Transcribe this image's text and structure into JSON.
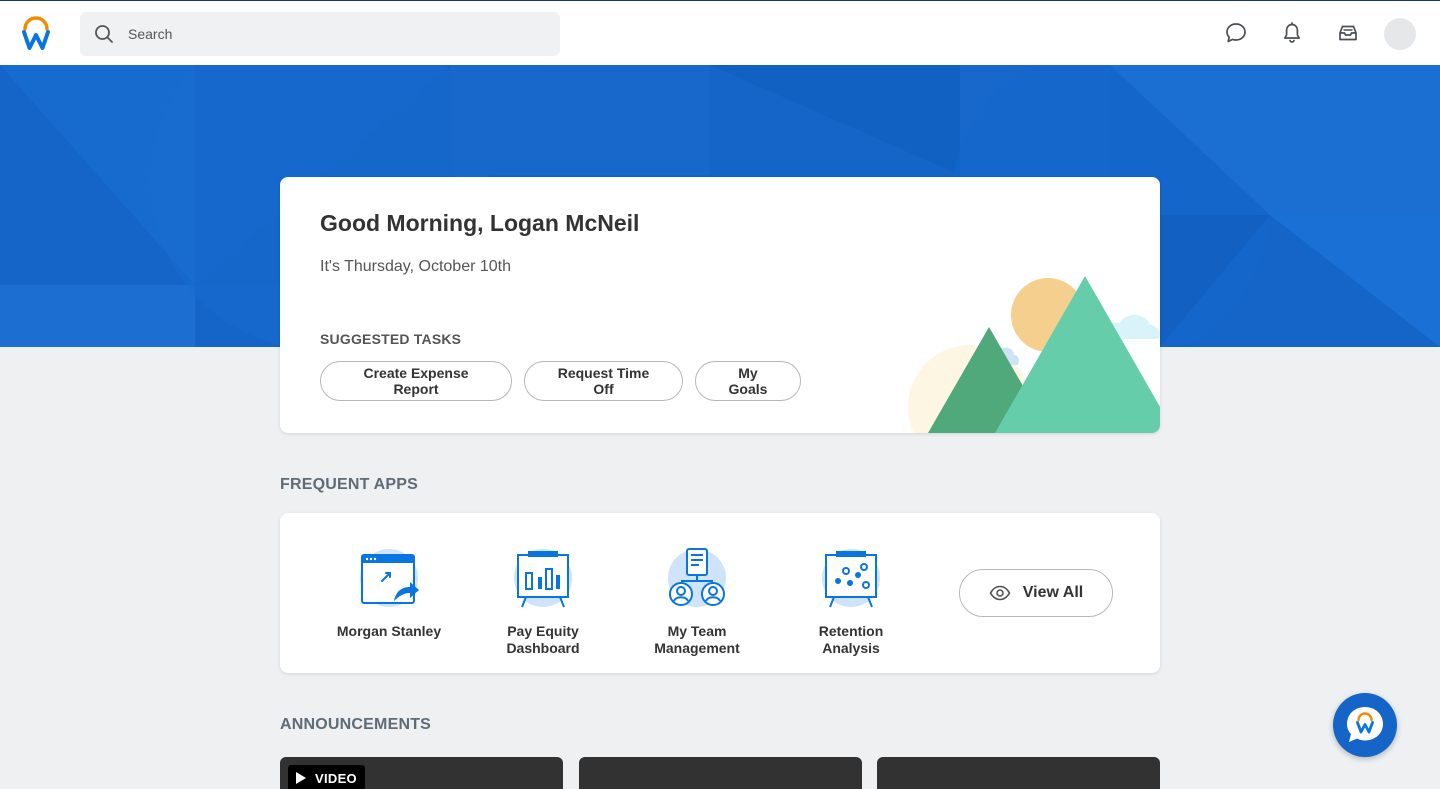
{
  "header": {
    "logo_name": "workday-logo",
    "search": {
      "placeholder": "Search",
      "value": ""
    },
    "icons": [
      "chat-icon",
      "notifications-icon",
      "inbox-icon"
    ]
  },
  "greeting": {
    "title": "Good Morning, Logan McNeil",
    "date": "It's Thursday, October 10th",
    "suggested_label": "SUGGESTED TASKS",
    "tasks": [
      {
        "label": "Create Expense Report"
      },
      {
        "label": "Request Time Off"
      },
      {
        "label": "My Goals"
      }
    ]
  },
  "frequent_apps": {
    "title": "FREQUENT APPS",
    "apps": [
      {
        "line1": "Morgan Stanley",
        "line2": "",
        "icon": "external-link-icon"
      },
      {
        "line1": "Pay Equity",
        "line2": "Dashboard",
        "icon": "bar-chart-board-icon"
      },
      {
        "line1": "My Team",
        "line2": "Management",
        "icon": "team-icon"
      },
      {
        "line1": "Retention",
        "line2": "Analysis",
        "icon": "scatter-board-icon"
      }
    ],
    "view_all_label": "View All"
  },
  "announcements": {
    "title": "ANNOUNCEMENTS",
    "video_badge": "VIDEO"
  },
  "colors": {
    "brand_blue": "#1565c9",
    "background": "#eef0f2",
    "mountain_dark": "#4fa97b",
    "mountain_light": "#66cdaa",
    "sun": "#f5cf8e"
  }
}
